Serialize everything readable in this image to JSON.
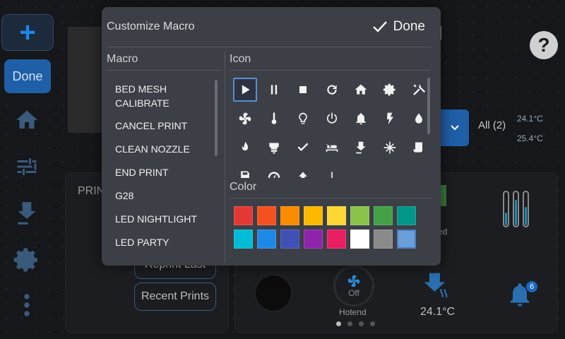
{
  "nav": {
    "add_label": "+",
    "done_label": "Done",
    "items": [
      "home-icon",
      "tune-icon",
      "extrude-icon",
      "gear-icon",
      "more-icon"
    ]
  },
  "background": {
    "title_fragment": "d",
    "help_label": "?",
    "all_label": "All (2)",
    "temp_1": "24.1°C",
    "temp_2": "25.4°C",
    "print_label": "PRIN",
    "reprint_label": "Reprint Last",
    "recent_label": "Recent Prints",
    "fan_label": "Off",
    "hotend_label": "Hotend",
    "temp_value": "24.1°C",
    "led_label": "ed",
    "notif_count": "6"
  },
  "modal": {
    "title": "Customize Macro",
    "done_label": "Done",
    "macro_header": "Macro",
    "icon_header": "Icon",
    "color_header": "Color",
    "macros": [
      "BED MESH CALIBRATE",
      "CANCEL PRINT",
      "CLEAN NOZZLE",
      "END PRINT",
      "G28",
      "LED NIGHTLIGHT",
      "LED PARTY"
    ],
    "icons": [
      [
        "play-icon",
        "pause-icon",
        "stop-icon",
        "refresh-icon",
        "home-icon",
        "gear-icon",
        "tools-icon"
      ],
      [
        "fan-icon",
        "thermometer-icon",
        "lightbulb-icon",
        "power-icon",
        "bell-icon",
        "lightning-icon",
        "drop-icon"
      ],
      [
        "flame-icon",
        "printer-head-icon",
        "check-icon",
        "bed-icon",
        "extrude-icon",
        "snowflake-icon",
        "scroll-icon"
      ],
      [
        "save-icon",
        "speed-icon",
        "up-icon",
        "line-icon"
      ]
    ],
    "selected_icon": "play-icon",
    "colors": [
      "#e53935",
      "#f4511e",
      "#fb8c00",
      "#fdb900",
      "#fdd835",
      "#8bc34a",
      "#43a047",
      "#009688",
      "#00bcd4",
      "#1e88e5",
      "#3f51b5",
      "#8e24aa",
      "#e91e63",
      "#ffffff",
      "#8a8a8a",
      "#6a9fd8"
    ],
    "selected_color": "#6a9fd8"
  }
}
